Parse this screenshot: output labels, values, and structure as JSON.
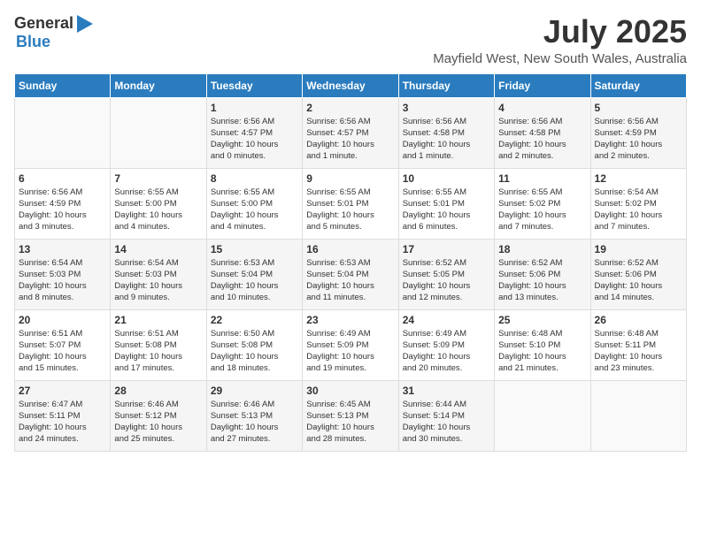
{
  "header": {
    "logo_general": "General",
    "logo_blue": "Blue",
    "month_title": "July 2025",
    "location": "Mayfield West, New South Wales, Australia"
  },
  "days_of_week": [
    "Sunday",
    "Monday",
    "Tuesday",
    "Wednesday",
    "Thursday",
    "Friday",
    "Saturday"
  ],
  "weeks": [
    [
      {
        "day": "",
        "info": ""
      },
      {
        "day": "",
        "info": ""
      },
      {
        "day": "1",
        "info": "Sunrise: 6:56 AM\nSunset: 4:57 PM\nDaylight: 10 hours\nand 0 minutes."
      },
      {
        "day": "2",
        "info": "Sunrise: 6:56 AM\nSunset: 4:57 PM\nDaylight: 10 hours\nand 1 minute."
      },
      {
        "day": "3",
        "info": "Sunrise: 6:56 AM\nSunset: 4:58 PM\nDaylight: 10 hours\nand 1 minute."
      },
      {
        "day": "4",
        "info": "Sunrise: 6:56 AM\nSunset: 4:58 PM\nDaylight: 10 hours\nand 2 minutes."
      },
      {
        "day": "5",
        "info": "Sunrise: 6:56 AM\nSunset: 4:59 PM\nDaylight: 10 hours\nand 2 minutes."
      }
    ],
    [
      {
        "day": "6",
        "info": "Sunrise: 6:56 AM\nSunset: 4:59 PM\nDaylight: 10 hours\nand 3 minutes."
      },
      {
        "day": "7",
        "info": "Sunrise: 6:55 AM\nSunset: 5:00 PM\nDaylight: 10 hours\nand 4 minutes."
      },
      {
        "day": "8",
        "info": "Sunrise: 6:55 AM\nSunset: 5:00 PM\nDaylight: 10 hours\nand 4 minutes."
      },
      {
        "day": "9",
        "info": "Sunrise: 6:55 AM\nSunset: 5:01 PM\nDaylight: 10 hours\nand 5 minutes."
      },
      {
        "day": "10",
        "info": "Sunrise: 6:55 AM\nSunset: 5:01 PM\nDaylight: 10 hours\nand 6 minutes."
      },
      {
        "day": "11",
        "info": "Sunrise: 6:55 AM\nSunset: 5:02 PM\nDaylight: 10 hours\nand 7 minutes."
      },
      {
        "day": "12",
        "info": "Sunrise: 6:54 AM\nSunset: 5:02 PM\nDaylight: 10 hours\nand 7 minutes."
      }
    ],
    [
      {
        "day": "13",
        "info": "Sunrise: 6:54 AM\nSunset: 5:03 PM\nDaylight: 10 hours\nand 8 minutes."
      },
      {
        "day": "14",
        "info": "Sunrise: 6:54 AM\nSunset: 5:03 PM\nDaylight: 10 hours\nand 9 minutes."
      },
      {
        "day": "15",
        "info": "Sunrise: 6:53 AM\nSunset: 5:04 PM\nDaylight: 10 hours\nand 10 minutes."
      },
      {
        "day": "16",
        "info": "Sunrise: 6:53 AM\nSunset: 5:04 PM\nDaylight: 10 hours\nand 11 minutes."
      },
      {
        "day": "17",
        "info": "Sunrise: 6:52 AM\nSunset: 5:05 PM\nDaylight: 10 hours\nand 12 minutes."
      },
      {
        "day": "18",
        "info": "Sunrise: 6:52 AM\nSunset: 5:06 PM\nDaylight: 10 hours\nand 13 minutes."
      },
      {
        "day": "19",
        "info": "Sunrise: 6:52 AM\nSunset: 5:06 PM\nDaylight: 10 hours\nand 14 minutes."
      }
    ],
    [
      {
        "day": "20",
        "info": "Sunrise: 6:51 AM\nSunset: 5:07 PM\nDaylight: 10 hours\nand 15 minutes."
      },
      {
        "day": "21",
        "info": "Sunrise: 6:51 AM\nSunset: 5:08 PM\nDaylight: 10 hours\nand 17 minutes."
      },
      {
        "day": "22",
        "info": "Sunrise: 6:50 AM\nSunset: 5:08 PM\nDaylight: 10 hours\nand 18 minutes."
      },
      {
        "day": "23",
        "info": "Sunrise: 6:49 AM\nSunset: 5:09 PM\nDaylight: 10 hours\nand 19 minutes."
      },
      {
        "day": "24",
        "info": "Sunrise: 6:49 AM\nSunset: 5:09 PM\nDaylight: 10 hours\nand 20 minutes."
      },
      {
        "day": "25",
        "info": "Sunrise: 6:48 AM\nSunset: 5:10 PM\nDaylight: 10 hours\nand 21 minutes."
      },
      {
        "day": "26",
        "info": "Sunrise: 6:48 AM\nSunset: 5:11 PM\nDaylight: 10 hours\nand 23 minutes."
      }
    ],
    [
      {
        "day": "27",
        "info": "Sunrise: 6:47 AM\nSunset: 5:11 PM\nDaylight: 10 hours\nand 24 minutes."
      },
      {
        "day": "28",
        "info": "Sunrise: 6:46 AM\nSunset: 5:12 PM\nDaylight: 10 hours\nand 25 minutes."
      },
      {
        "day": "29",
        "info": "Sunrise: 6:46 AM\nSunset: 5:13 PM\nDaylight: 10 hours\nand 27 minutes."
      },
      {
        "day": "30",
        "info": "Sunrise: 6:45 AM\nSunset: 5:13 PM\nDaylight: 10 hours\nand 28 minutes."
      },
      {
        "day": "31",
        "info": "Sunrise: 6:44 AM\nSunset: 5:14 PM\nDaylight: 10 hours\nand 30 minutes."
      },
      {
        "day": "",
        "info": ""
      },
      {
        "day": "",
        "info": ""
      }
    ]
  ]
}
